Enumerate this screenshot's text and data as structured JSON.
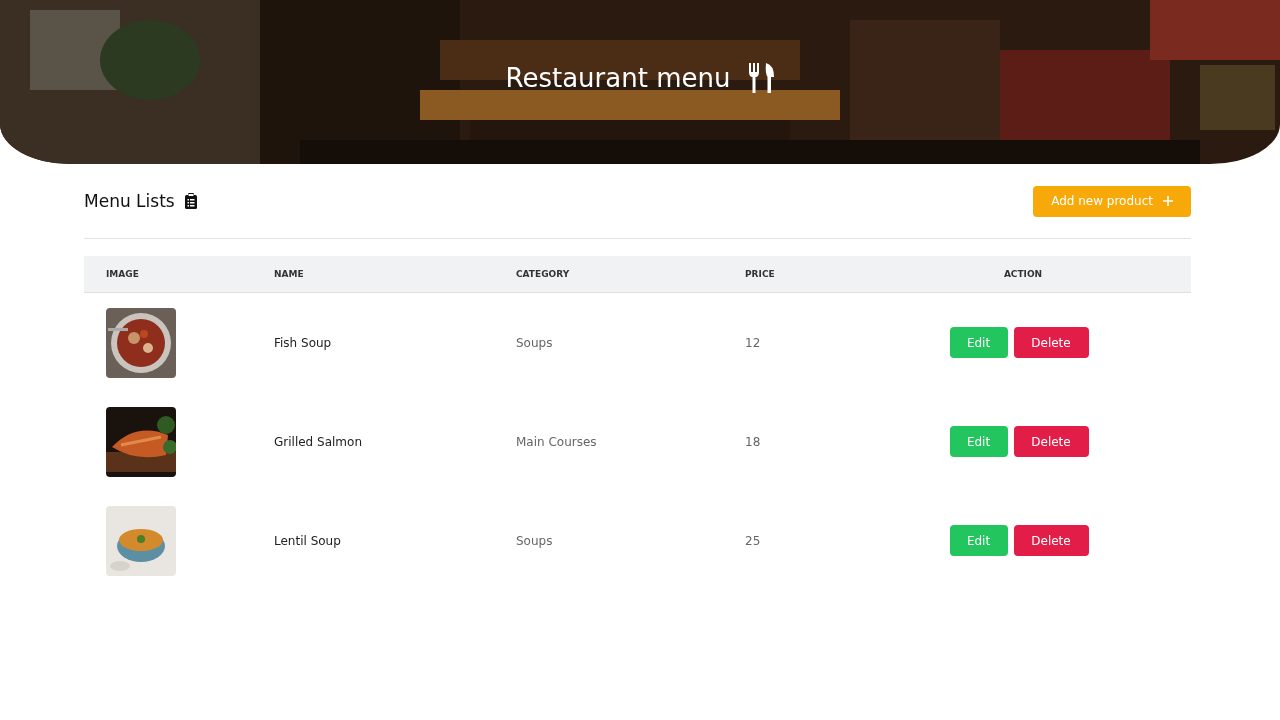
{
  "header": {
    "title": "Restaurant menu",
    "background": {
      "kind": "picture"
    }
  },
  "section": {
    "title": "Menu Lists",
    "add_button": {
      "label": "Add new product"
    }
  },
  "table": {
    "columns": [
      "IMAGE",
      "NAME",
      "CATEGORY",
      "PRICE",
      "ACTION"
    ],
    "rows": [
      {
        "image": {
          "kind": "picture"
        },
        "name": "Fish Soup",
        "category": "Soups",
        "price": "12",
        "actions": [
          {
            "kind": "edit",
            "label": "Edit"
          },
          {
            "kind": "delete",
            "label": "Delete"
          }
        ]
      },
      {
        "image": {
          "kind": "picture"
        },
        "name": "Grilled Salmon",
        "category": "Main Courses",
        "price": "18",
        "actions": [
          {
            "kind": "edit",
            "label": "Edit"
          },
          {
            "kind": "delete",
            "label": "Delete"
          }
        ]
      },
      {
        "image": {
          "kind": "picture"
        },
        "name": "Lentil Soup",
        "category": "Soups",
        "price": "25",
        "actions": [
          {
            "kind": "edit",
            "label": "Edit"
          },
          {
            "kind": "delete",
            "label": "Delete"
          }
        ]
      }
    ]
  }
}
